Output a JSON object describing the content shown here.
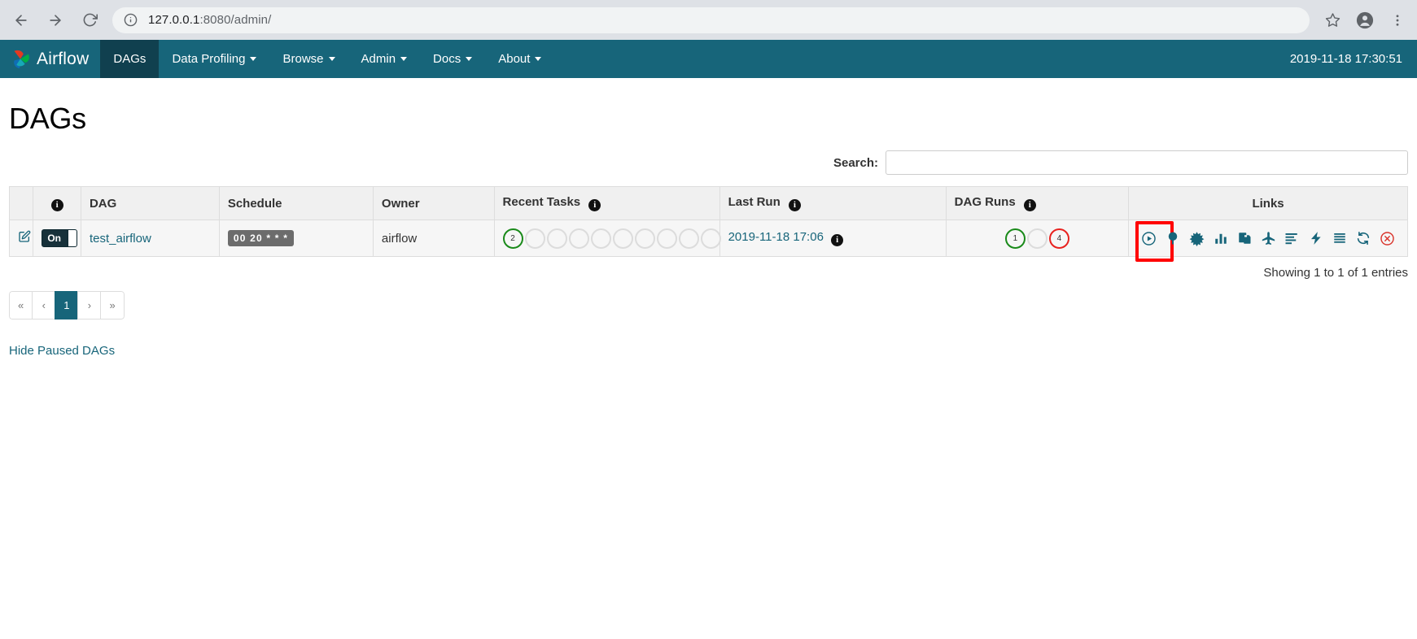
{
  "browser": {
    "url_host": "127.0.0.1",
    "url_rest": ":8080/admin/",
    "back_icon": "back-arrow-icon",
    "forward_icon": "forward-arrow-icon",
    "reload_icon": "reload-icon",
    "info_icon": "site-info-icon",
    "star_icon": "bookmark-star-icon",
    "profile_icon": "profile-avatar-icon",
    "menu_icon": "three-dot-menu-icon"
  },
  "navbar": {
    "brand": "Airflow",
    "items": [
      {
        "label": "DAGs",
        "active": true,
        "caret": false
      },
      {
        "label": "Data Profiling",
        "active": false,
        "caret": true
      },
      {
        "label": "Browse",
        "active": false,
        "caret": true
      },
      {
        "label": "Admin",
        "active": false,
        "caret": true
      },
      {
        "label": "Docs",
        "active": false,
        "caret": true
      },
      {
        "label": "About",
        "active": false,
        "caret": true
      }
    ],
    "clock": "2019-11-18 17:30:51"
  },
  "page": {
    "title": "DAGs"
  },
  "search": {
    "label": "Search:",
    "value": "",
    "placeholder": ""
  },
  "table": {
    "headers": {
      "edit": "",
      "info": "",
      "dag": "DAG",
      "schedule": "Schedule",
      "owner": "Owner",
      "recent_tasks": "Recent Tasks",
      "last_run": "Last Run",
      "dag_runs": "DAG Runs",
      "spacer": "",
      "links": "Links"
    },
    "rows": [
      {
        "toggle_label": "On",
        "dag_name": "test_airflow",
        "schedule": "00 20 * * *",
        "owner": "airflow",
        "recent_tasks": [
          {
            "count": "2",
            "state": "success"
          },
          {
            "count": "",
            "state": "empty"
          },
          {
            "count": "",
            "state": "empty"
          },
          {
            "count": "",
            "state": "empty"
          },
          {
            "count": "",
            "state": "empty"
          },
          {
            "count": "",
            "state": "empty"
          },
          {
            "count": "",
            "state": "empty"
          },
          {
            "count": "",
            "state": "empty"
          },
          {
            "count": "",
            "state": "empty"
          },
          {
            "count": "",
            "state": "empty"
          }
        ],
        "last_run": "2019-11-18 17:06",
        "dag_runs": [
          {
            "count": "1",
            "state": "success"
          },
          {
            "count": "",
            "state": "empty"
          },
          {
            "count": "4",
            "state": "failed"
          }
        ],
        "links": [
          {
            "name": "trigger-dag-icon",
            "title": "Trigger Dag",
            "highlight": true,
            "danger": false
          },
          {
            "name": "tree-view-icon",
            "title": "Tree View",
            "highlight": false,
            "danger": false
          },
          {
            "name": "graph-view-icon",
            "title": "Graph View",
            "highlight": false,
            "danger": false
          },
          {
            "name": "task-duration-icon",
            "title": "Task Duration",
            "highlight": false,
            "danger": false
          },
          {
            "name": "task-tries-icon",
            "title": "Task Tries",
            "highlight": false,
            "danger": false
          },
          {
            "name": "landing-times-icon",
            "title": "Landing Times",
            "highlight": false,
            "danger": false
          },
          {
            "name": "gantt-icon",
            "title": "Gantt",
            "highlight": false,
            "danger": false
          },
          {
            "name": "code-icon",
            "title": "Code",
            "highlight": false,
            "danger": false
          },
          {
            "name": "logs-icon",
            "title": "Logs",
            "highlight": false,
            "danger": false
          },
          {
            "name": "refresh-icon",
            "title": "Refresh",
            "highlight": false,
            "danger": false
          },
          {
            "name": "delete-dag-icon",
            "title": "Delete Dag",
            "highlight": false,
            "danger": true
          }
        ]
      }
    ]
  },
  "footer": {
    "showing": "Showing 1 to 1 of 1 entries",
    "pagination": [
      {
        "label": "«",
        "active": false,
        "name": "pagination-first"
      },
      {
        "label": "‹",
        "active": false,
        "name": "pagination-prev"
      },
      {
        "label": "1",
        "active": true,
        "name": "pagination-page-1"
      },
      {
        "label": "›",
        "active": false,
        "name": "pagination-next"
      },
      {
        "label": "»",
        "active": false,
        "name": "pagination-last"
      }
    ],
    "hide_paused": "Hide Paused DAGs"
  }
}
